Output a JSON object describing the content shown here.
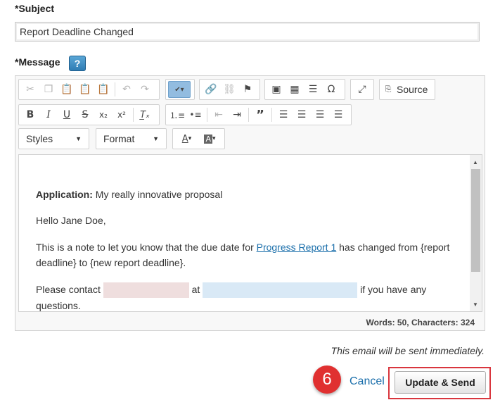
{
  "subject": {
    "label": "Subject",
    "required_mark": "*",
    "value": "Report Deadline Changed"
  },
  "message": {
    "label": "Message",
    "required_mark": "*",
    "help_icon": "?"
  },
  "toolbar": {
    "row1": [
      "cut-icon",
      "copy-icon",
      "paste-icon",
      "paste-text-icon",
      "paste-word-icon",
      "undo-icon",
      "redo-icon",
      "spellcheck-icon",
      "link-icon",
      "unlink-icon",
      "anchor-icon",
      "image-icon",
      "table-icon",
      "horizontal-line-icon",
      "special-char-icon",
      "maximize-icon",
      "source-icon"
    ],
    "source_label": "Source",
    "row2": [
      "bold-icon",
      "italic-icon",
      "underline-icon",
      "strike-icon",
      "subscript-icon",
      "superscript-icon",
      "remove-format-icon",
      "numbered-list-icon",
      "bulleted-list-icon",
      "outdent-icon",
      "indent-icon",
      "blockquote-icon",
      "align-left-icon",
      "align-center-icon",
      "align-right-icon",
      "justify-icon"
    ],
    "styles_label": "Styles",
    "format_label": "Format"
  },
  "body": {
    "application_label": "Application:",
    "application_value": "My really innovative proposal",
    "greeting": "Hello Jane Doe,",
    "note_before": "This is a note to let you know that the due date for",
    "note_link": "Progress Report 1",
    "note_after": "has changed from {report deadline} to {new report deadline}.",
    "contact_before": "Please contact",
    "contact_at": "at",
    "contact_after": "if you have any questions."
  },
  "word_count": "Words: 50, Characters: 324",
  "notice": "This email will be sent immediately.",
  "step_number": "6",
  "cancel_label": "Cancel",
  "send_label": "Update & Send",
  "colors": {
    "link": "#1b6fab",
    "accent_red": "#e03030",
    "spellcheck_active": "#92bce0"
  }
}
